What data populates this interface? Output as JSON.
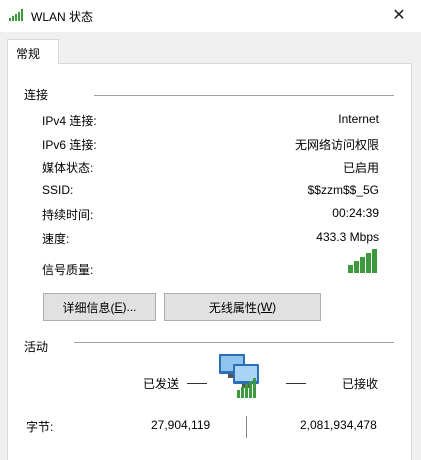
{
  "window": {
    "title": "WLAN 状态",
    "close_glyph": "✕"
  },
  "tabs": [
    {
      "label": "常规"
    }
  ],
  "connection": {
    "section_title": "连接",
    "rows": [
      {
        "label": "IPv4 连接:",
        "value": "Internet"
      },
      {
        "label": "IPv6 连接:",
        "value": "无网络访问权限"
      },
      {
        "label": "媒体状态:",
        "value": "已启用"
      },
      {
        "label": "SSID:",
        "value": "$$zzm$$_5G"
      },
      {
        "label": "持续时间:",
        "value": "00:24:39"
      },
      {
        "label": "速度:",
        "value": "433.3 Mbps"
      }
    ],
    "signal_label": "信号质量:",
    "signal_bars": 5,
    "signal_color": "#3c9a3c"
  },
  "buttons": {
    "details": {
      "pre": "详细信息(",
      "key": "E",
      "post": ")..."
    },
    "wireless": {
      "pre": "无线属性(",
      "key": "W",
      "post": ")"
    }
  },
  "activity": {
    "section_title": "活动",
    "sent_label": "已发送",
    "received_label": "已接收",
    "bytes_label": "字节:",
    "bytes_sent": "27,904,119",
    "bytes_received": "2,081,934,478"
  }
}
